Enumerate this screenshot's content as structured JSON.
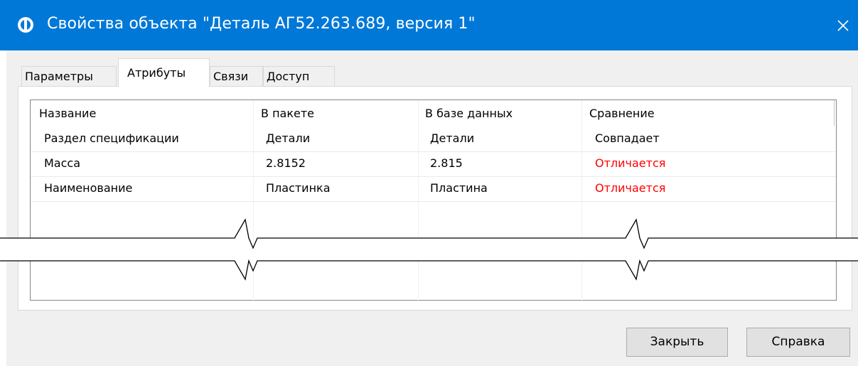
{
  "window": {
    "title": "Свойства объекта \"Деталь АГ52.263.689, версия 1\"",
    "title_bar_color": "#0078d7",
    "icon": "app-logo-icon"
  },
  "tabs": [
    {
      "label": "Параметры",
      "active": false
    },
    {
      "label": "Атрибуты",
      "active": true
    },
    {
      "label": "Связи",
      "active": false
    },
    {
      "label": "Доступ",
      "active": false
    }
  ],
  "table": {
    "columns": [
      "Название",
      "В пакете",
      "В базе данных",
      "Сравнение"
    ],
    "rows": [
      {
        "name": "Раздел спецификации",
        "package": "Детали",
        "database": "Детали",
        "comparison": "Совпадает",
        "differs": false
      },
      {
        "name": "Масса",
        "package": "2.8152",
        "database": "2.815",
        "comparison": "Отличается",
        "differs": true
      },
      {
        "name": "Наименование",
        "package": "Пластинка",
        "database": "Пластина",
        "comparison": "Отличается",
        "differs": true
      }
    ]
  },
  "buttons": {
    "close": "Закрыть",
    "help": "Справка"
  },
  "colors": {
    "differs_text": "#ff0000"
  }
}
